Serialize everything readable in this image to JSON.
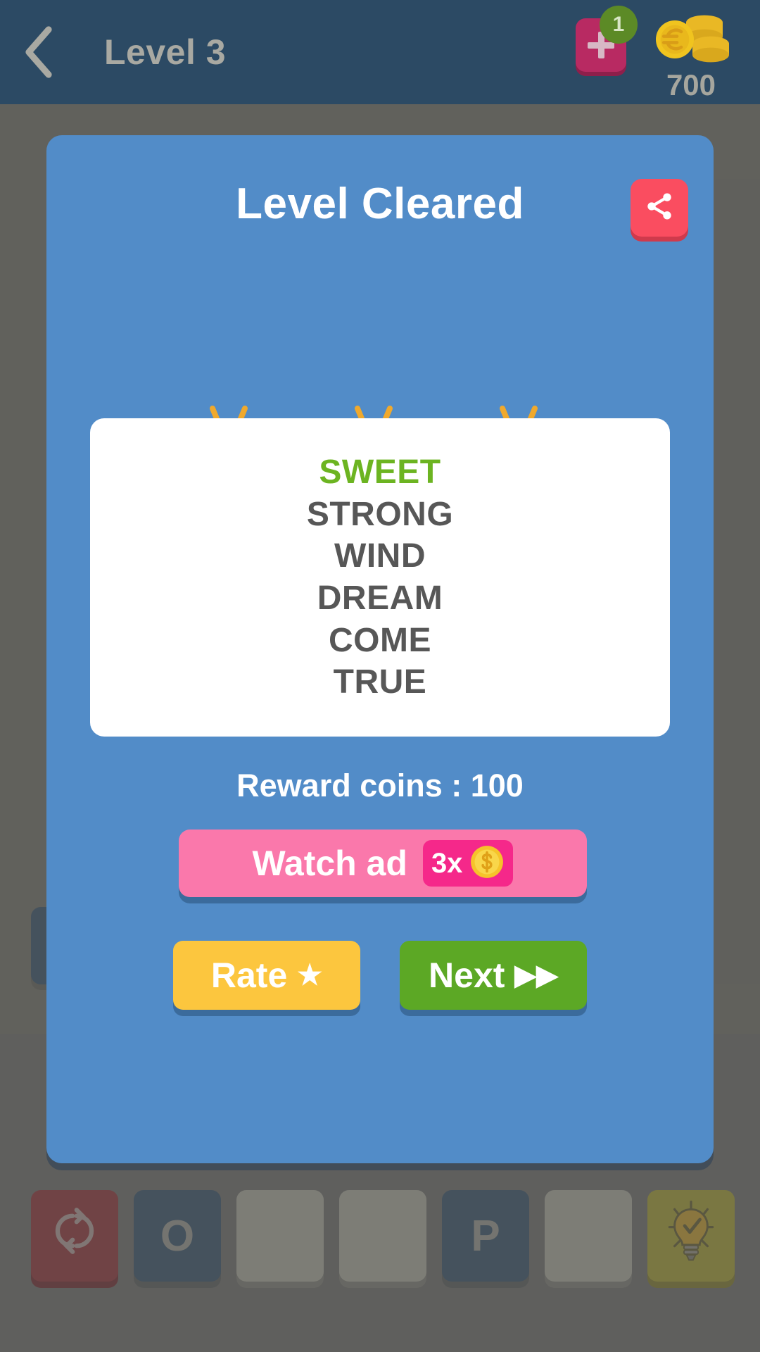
{
  "app_bar": {
    "back_icon": "chevron-left-icon",
    "title": "Level 3",
    "add_hint": {
      "icon": "plus-icon",
      "badge_count": "1"
    },
    "coins": {
      "icon": "euro-coin-stack-icon",
      "amount": "700"
    }
  },
  "dialog": {
    "title": "Level Cleared",
    "share_icon": "share-icon",
    "stars": {
      "count": 3,
      "filled_color": "#f7cf3e",
      "shade_color": "#e8bb2e",
      "ray_color": "#f0a92d"
    },
    "words": [
      {
        "text": "SWEET",
        "solved": true
      },
      {
        "text": "STRONG",
        "solved": false
      },
      {
        "text": "WIND",
        "solved": false
      },
      {
        "text": "DREAM",
        "solved": false
      },
      {
        "text": "COME",
        "solved": false
      },
      {
        "text": "TRUE",
        "solved": false
      }
    ],
    "reward_text": "Reward coins : 100",
    "watch_ad": {
      "label": "Watch ad",
      "multiplier": "3x",
      "coin_icon": "dollar-coin-icon"
    },
    "rate_button": {
      "label": "Rate",
      "glyph": "★",
      "icon": "star-icon"
    },
    "next_button": {
      "label": "Next",
      "glyph": "▶▶",
      "icon": "fast-forward-icon"
    }
  },
  "board": {
    "answer_slots": 5,
    "letter_tiles": [
      {
        "type": "shuffle",
        "label": "",
        "icon": "shuffle-icon"
      },
      {
        "type": "filled",
        "label": "O",
        "icon": ""
      },
      {
        "type": "empty",
        "label": "",
        "icon": ""
      },
      {
        "type": "empty",
        "label": "",
        "icon": ""
      },
      {
        "type": "filled",
        "label": "P",
        "icon": ""
      },
      {
        "type": "empty",
        "label": "",
        "icon": ""
      },
      {
        "type": "hint",
        "label": "",
        "icon": "lightbulb-icon"
      }
    ]
  },
  "colors": {
    "app_bar": "#2c4a64",
    "dialog": "#528cc8",
    "overlay": "#7b7b77",
    "solved_word": "#6cb421",
    "watch_ad": "#fa78ab",
    "rate": "#fcc63e",
    "next": "#5ca825",
    "share": "#fa4d60"
  }
}
